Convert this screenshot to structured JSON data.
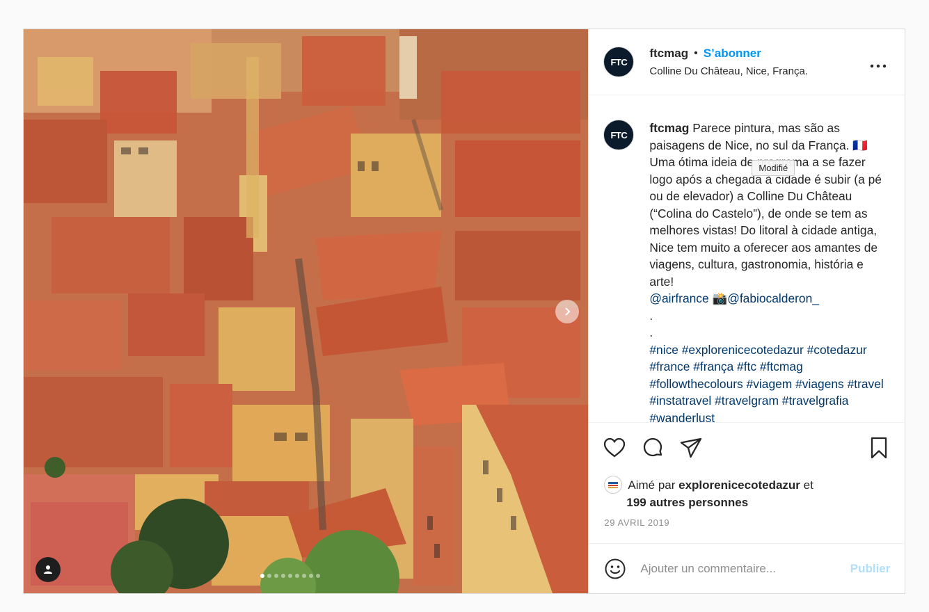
{
  "post": {
    "account": {
      "username": "ftcmag",
      "avatar_text": "FTC",
      "follow_label": "S’abonner",
      "separator": "•",
      "location": "Colline Du Château, Nice, França."
    },
    "more_icon": "more-horizontal-icon",
    "photo": {
      "subject": "aerial view of old town rooftops",
      "carousel_dot_count": 9,
      "carousel_active_index": 0
    },
    "caption": {
      "username": "ftcmag",
      "text_part1": "Parece pintura, mas são as paisagens de Nice, no sul da França. 🇫🇷 Uma ótima ideia de programa a se fazer logo após a chegada à cidade é subir (a pé ou de elevador) a Colline Du Château (“Colina do Castelo”), de onde se tem as melhores vistas! Do litoral à cidade antiga, Nice tem muito a oferecer aos amantes de viagens, cultura, gastronomia, história e arte!",
      "mention1": "@airfrance",
      "camera_emoji": "📸",
      "mention2": "@fabiocalderon_",
      "dot1": ".",
      "dot2": ".",
      "hashtags": "#nice #explorenicecotedazur #cotedazur #france #frança #ftc #ftcmag #followthecolours #viagem #viagens #travel #instatravel #travelgram #travelgrafia #wanderlust"
    },
    "tooltip": "Modifié",
    "actions": {
      "like_icon": "heart-icon",
      "comment_icon": "comment-icon",
      "share_icon": "send-icon",
      "save_icon": "bookmark-icon"
    },
    "likes": {
      "prefix": "Aimé par",
      "liker": "explorenicecotedazur",
      "conj": "et",
      "others": "199 autres personnes"
    },
    "date": "29 AVRIL 2019",
    "comment": {
      "placeholder": "Ajouter un commentaire...",
      "publish_label": "Publier"
    },
    "colors": {
      "accent": "#0095f6",
      "link": "#00376b",
      "publish_disabled": "#b2dffc"
    }
  }
}
